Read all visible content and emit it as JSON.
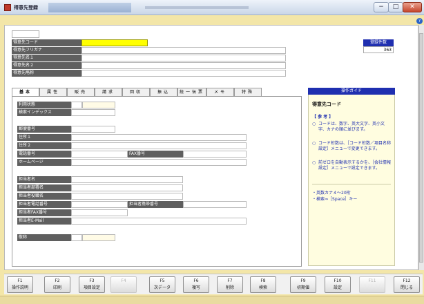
{
  "window": {
    "title": "得意先登録",
    "min": "−",
    "max": "□",
    "close": "✕",
    "help": "?"
  },
  "header_fields": [
    {
      "label": "得意先コード",
      "value": ""
    },
    {
      "label": "得意先フリガナ",
      "value": ""
    },
    {
      "label": "得意先名１",
      "value": ""
    },
    {
      "label": "得意先名２",
      "value": ""
    },
    {
      "label": "得意先略称",
      "value": ""
    }
  ],
  "registered": {
    "label": "登録件数",
    "value": "363"
  },
  "tabs": [
    "基本",
    "属性",
    "販売",
    "請求",
    "回収",
    "振込",
    "統一伝票",
    "メモ",
    "特殊"
  ],
  "basic": {
    "usage": "利用状態",
    "index": "検索インデックス",
    "zip": "郵便番号",
    "addr1": "住所１",
    "addr2": "住所２",
    "tel": "電話番号",
    "fax": "FAX番号",
    "homepage": "ホームページ",
    "contact_name": "担当者名",
    "contact_dept": "担当者部署名",
    "contact_title": "担当者役職名",
    "contact_tel": "担当者電話番号",
    "contact_mobile": "担当者携帯番号",
    "contact_fax": "担当者FAX番号",
    "contact_email": "担当者E-Mail",
    "honorific": "敬称"
  },
  "guide": {
    "header": "操作ガイド",
    "title": "得意先コード",
    "ref": "【 参 考 】",
    "items": [
      "コードは、数字、英大文字、英小文字、カナの順に並びます。",
      "コード桁数は、［コード桁数／項目名称設定］メニューで変更できます。",
      "前ゼロを自動表示するかを、［会社情報設定］メニューで設定できます。"
    ],
    "notes": [
      "・英数カナ４～20桁",
      "・検索⇒［Space］キー"
    ]
  },
  "fkeys": [
    {
      "key": "F1",
      "label": "操作説明",
      "enabled": true
    },
    {
      "key": "F2",
      "label": "印刷",
      "enabled": true
    },
    {
      "key": "F3",
      "label": "項目設定",
      "enabled": true
    },
    {
      "key": "F4",
      "label": "",
      "enabled": false
    },
    {
      "key": "F5",
      "label": "次データ",
      "enabled": true
    },
    {
      "key": "F6",
      "label": "複写",
      "enabled": true
    },
    {
      "key": "F7",
      "label": "削除",
      "enabled": true
    },
    {
      "key": "F8",
      "label": "検索",
      "enabled": true
    },
    {
      "key": "F9",
      "label": "初期値",
      "enabled": true
    },
    {
      "key": "F10",
      "label": "設定",
      "enabled": true
    },
    {
      "key": "F11",
      "label": "",
      "enabled": false
    },
    {
      "key": "F12",
      "label": "閉じる",
      "enabled": true
    }
  ],
  "colors": {
    "accent": "#1f2fb0",
    "label_bg": "#5f5f5f",
    "active_field": "#ffff00",
    "window_bg": "#f3e6a8"
  },
  "icons": [
    "app-icon",
    "help-icon"
  ]
}
